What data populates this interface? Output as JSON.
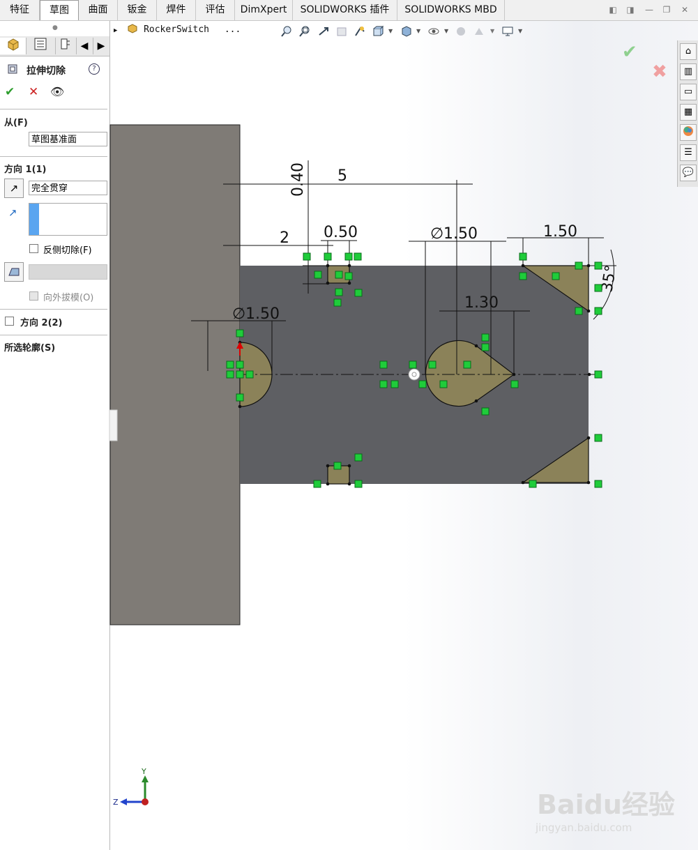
{
  "tabs": [
    "特征",
    "草图",
    "曲面",
    "钣金",
    "焊件",
    "评估",
    "DimXpert",
    "SOLIDWORKS 插件",
    "SOLIDWORKS MBD"
  ],
  "active_tab": "草图",
  "breadcrumb": {
    "part_name": "RockerSwitch",
    "ellipsis": "..."
  },
  "feature": {
    "title": "拉伸切除",
    "help": "?",
    "from_label": "从(F)",
    "from_value": "草图基准面",
    "dir1_label": "方向 1(1)",
    "dir1_value": "完全贯穿",
    "flip_side_label": "反侧切除(F)",
    "draft_outward_label": "向外拔模(O)",
    "dir2_label": "方向 2(2)",
    "selected_contours_label": "所选轮廓(S)"
  },
  "dimensions": {
    "d_040": "0.40",
    "d_5": "5",
    "d_2": "2",
    "d_050": "0.50",
    "d_dia_150_left": "1.50",
    "d_dia_150_mid": "1.50",
    "d_130": "1.30",
    "d_150_right": "1.50",
    "d_angle": "35°",
    "dia_symbol": "∅"
  },
  "triad": {
    "y": "Y",
    "z": "Z"
  },
  "watermark": {
    "brand": "Baidu经验",
    "url": "jingyan.baidu.com"
  },
  "colors": {
    "body_dark": "#5e5f63",
    "body_side": "#7f7b76",
    "sketch_fill": "#8b8259",
    "relation_green": "#1fcc3a",
    "accept": "#2e9e2e",
    "cancel": "#cc2222"
  }
}
